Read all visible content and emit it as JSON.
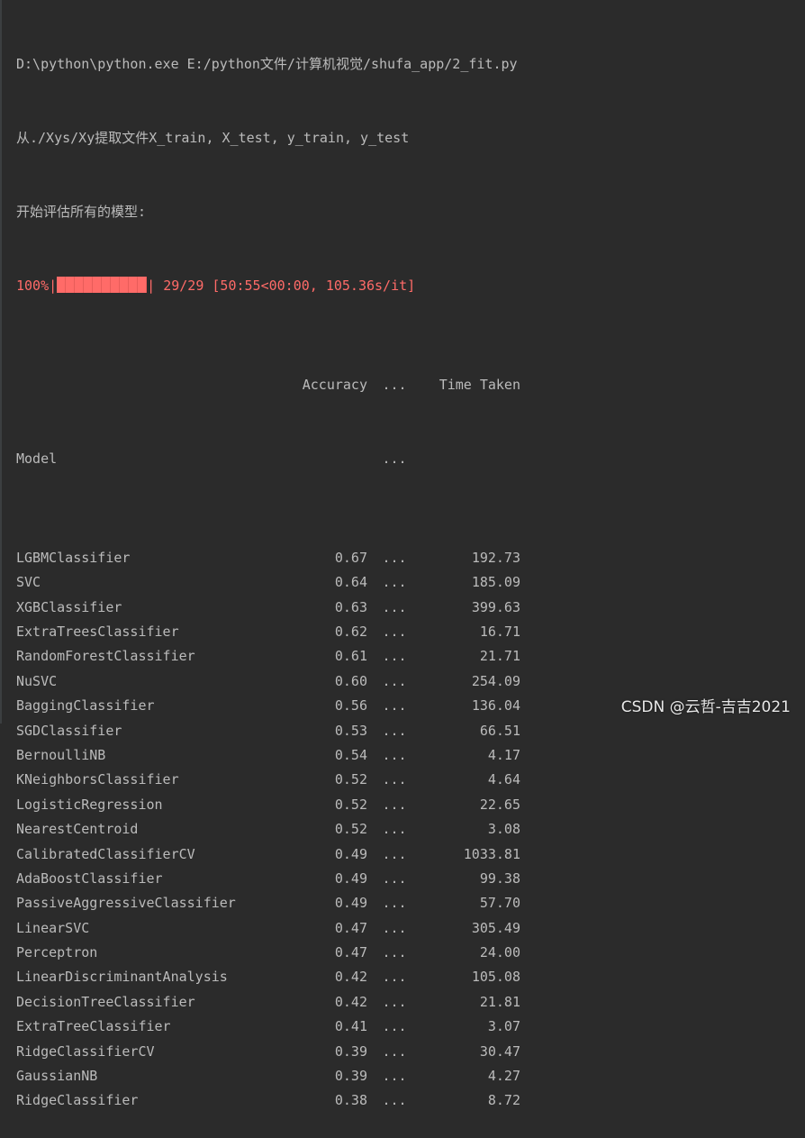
{
  "console": {
    "command": "D:\\python\\python.exe E:/python文件/计算机视觉/shufa_app/2_fit.py",
    "load_msg": "从./Xys/Xy提取文件X_train, X_test, y_train, y_test",
    "eval_msg": "开始评估所有的模型:",
    "progress": {
      "percent": "100%|",
      "tail": "| 29/29 [50:55<00:00, 105.36s/it]",
      "fraction": 1.0
    },
    "table": {
      "header_acc": "Accuracy",
      "header_dots": "...",
      "header_time": "Time Taken",
      "index_label": "Model",
      "index_dots": "...",
      "rows": [
        {
          "model": "LGBMClassifier",
          "acc": "0.67",
          "dots": "...",
          "time": "192.73"
        },
        {
          "model": "SVC",
          "acc": "0.64",
          "dots": "...",
          "time": "185.09"
        },
        {
          "model": "XGBClassifier",
          "acc": "0.63",
          "dots": "...",
          "time": "399.63"
        },
        {
          "model": "ExtraTreesClassifier",
          "acc": "0.62",
          "dots": "...",
          "time": "16.71"
        },
        {
          "model": "RandomForestClassifier",
          "acc": "0.61",
          "dots": "...",
          "time": "21.71"
        },
        {
          "model": "NuSVC",
          "acc": "0.60",
          "dots": "...",
          "time": "254.09"
        },
        {
          "model": "BaggingClassifier",
          "acc": "0.56",
          "dots": "...",
          "time": "136.04"
        },
        {
          "model": "SGDClassifier",
          "acc": "0.53",
          "dots": "...",
          "time": "66.51"
        },
        {
          "model": "BernoulliNB",
          "acc": "0.54",
          "dots": "...",
          "time": "4.17"
        },
        {
          "model": "KNeighborsClassifier",
          "acc": "0.52",
          "dots": "...",
          "time": "4.64"
        },
        {
          "model": "LogisticRegression",
          "acc": "0.52",
          "dots": "...",
          "time": "22.65"
        },
        {
          "model": "NearestCentroid",
          "acc": "0.52",
          "dots": "...",
          "time": "3.08"
        },
        {
          "model": "CalibratedClassifierCV",
          "acc": "0.49",
          "dots": "...",
          "time": "1033.81"
        },
        {
          "model": "AdaBoostClassifier",
          "acc": "0.49",
          "dots": "...",
          "time": "99.38"
        },
        {
          "model": "PassiveAggressiveClassifier",
          "acc": "0.49",
          "dots": "...",
          "time": "57.70"
        },
        {
          "model": "LinearSVC",
          "acc": "0.47",
          "dots": "...",
          "time": "305.49"
        },
        {
          "model": "Perceptron",
          "acc": "0.47",
          "dots": "...",
          "time": "24.00"
        },
        {
          "model": "LinearDiscriminantAnalysis",
          "acc": "0.42",
          "dots": "...",
          "time": "105.08"
        },
        {
          "model": "DecisionTreeClassifier",
          "acc": "0.42",
          "dots": "...",
          "time": "21.81"
        },
        {
          "model": "ExtraTreeClassifier",
          "acc": "0.41",
          "dots": "...",
          "time": "3.07"
        },
        {
          "model": "RidgeClassifierCV",
          "acc": "0.39",
          "dots": "...",
          "time": "30.47"
        },
        {
          "model": "GaussianNB",
          "acc": "0.39",
          "dots": "...",
          "time": "4.27"
        },
        {
          "model": "RidgeClassifier",
          "acc": "0.38",
          "dots": "...",
          "time": "8.72"
        }
      ]
    }
  },
  "watermark": "CSDN @云哲-吉吉2021",
  "colors": {
    "background": "#2b2b2b",
    "text": "#bbbbbb",
    "stderr": "#ff6b68"
  }
}
